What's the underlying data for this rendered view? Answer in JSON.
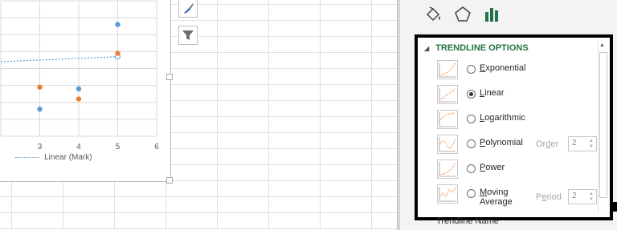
{
  "chart": {
    "x_ticks": [
      "3",
      "4",
      "5",
      "6"
    ],
    "legend_left": "n",
    "legend_linear": "Linear (Mark)"
  },
  "chart_data": {
    "type": "scatter",
    "xlim": [
      2,
      6
    ],
    "ylim": [
      0,
      8
    ],
    "series": [
      {
        "color": "#5b9bd5",
        "x": [
          3,
          4,
          5
        ],
        "y": [
          1.6,
          2.8,
          6.6
        ]
      },
      {
        "color": "#ed7d31",
        "x": [
          3,
          4,
          5
        ],
        "y": [
          2.9,
          2.2,
          4.9
        ]
      }
    ],
    "trendline": {
      "label": "Linear (Mark)",
      "x": [
        2,
        5
      ],
      "y": [
        4.4,
        4.7
      ],
      "style": "dotted",
      "color": "#5b9bd5"
    }
  },
  "pane": {
    "tabs": [
      "fill-line-icon",
      "effects-icon",
      "series-options-icon"
    ],
    "section_title": "TRENDLINE OPTIONS",
    "options": [
      {
        "key": "E",
        "rest": "xponential",
        "selected": false
      },
      {
        "key": "L",
        "rest": "inear",
        "selected": true
      },
      {
        "key": "L",
        "rest": "ogarithmic",
        "selected": false
      },
      {
        "key": "P",
        "rest": "olynomial",
        "selected": false,
        "order_label": "Order",
        "order_key": "d",
        "order_value": "2"
      },
      {
        "key": "P",
        "rest": "ower",
        "selected": false
      },
      {
        "key": "M",
        "rest": "oving",
        "line2": "Average",
        "selected": false,
        "period_label": "Period",
        "period_key": "e",
        "period_value": "2"
      }
    ],
    "trendline_name": "Trendline Name"
  },
  "colors": {
    "accent": "#217346",
    "series1": "#5b9bd5",
    "series2": "#ed7d31"
  }
}
